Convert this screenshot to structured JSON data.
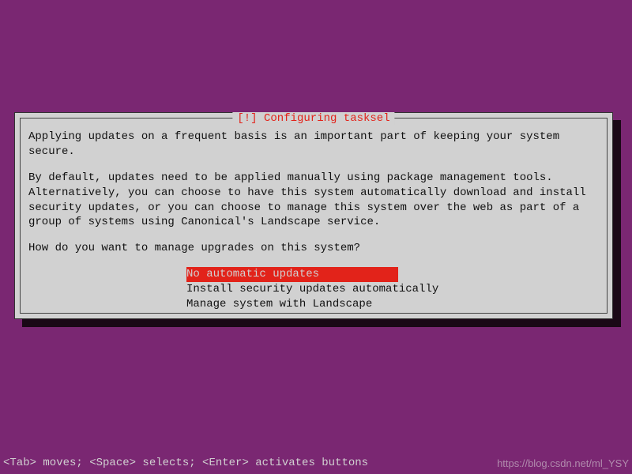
{
  "dialog": {
    "title": "[!] Configuring tasksel",
    "para1": "Applying updates on a frequent basis is an important part of keeping your system secure.",
    "para2": "By default, updates need to be applied manually using package management tools. Alternatively, you can choose to have this system automatically download and install security updates, or you can choose to manage this system over the web as part of a group of systems using Canonical's Landscape service.",
    "question": "How do you want to manage upgrades on this system?",
    "options": {
      "opt1": "No automatic updates",
      "opt2": "Install security updates automatically",
      "opt3": "Manage system with Landscape"
    }
  },
  "footer": {
    "hint": "<Tab> moves; <Space> selects; <Enter> activates buttons",
    "watermark": "https://blog.csdn.net/ml_YSY"
  }
}
